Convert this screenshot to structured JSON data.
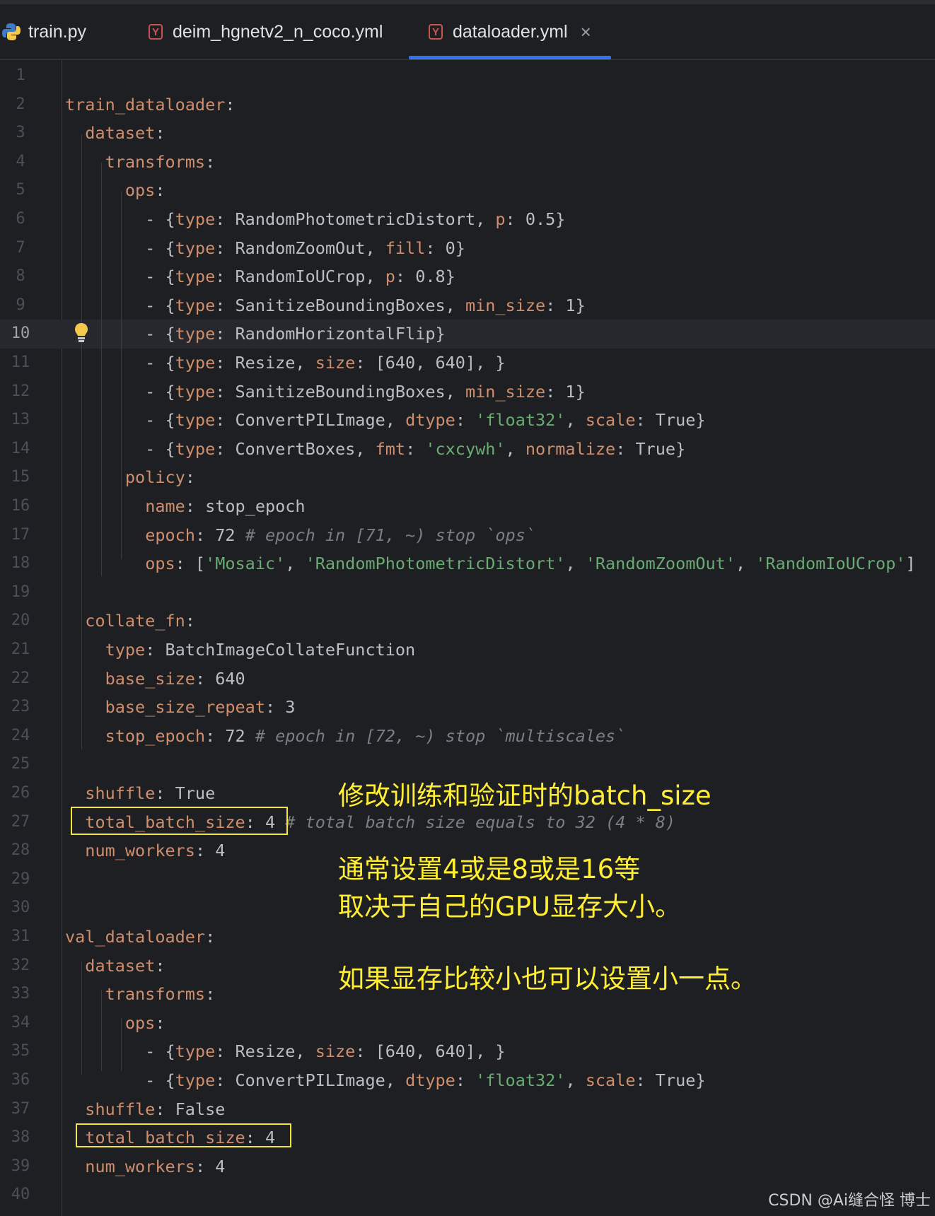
{
  "tabs": [
    {
      "label": "train.py",
      "icon": "python-file-icon"
    },
    {
      "label": "deim_hgnetv2_n_coco.yml",
      "icon": "yaml-file-icon"
    },
    {
      "label": "dataloader.yml",
      "icon": "yaml-file-icon",
      "active": true,
      "close": "×"
    }
  ],
  "editor": {
    "current_line": 10,
    "line_numbers": [
      "1",
      "2",
      "3",
      "4",
      "5",
      "6",
      "7",
      "8",
      "9",
      "10",
      "11",
      "12",
      "13",
      "14",
      "15",
      "16",
      "17",
      "18",
      "19",
      "20",
      "21",
      "22",
      "23",
      "24",
      "25",
      "26",
      "27",
      "28",
      "29",
      "30",
      "31",
      "32",
      "33",
      "34",
      "35",
      "36",
      "37",
      "38",
      "39",
      "40"
    ],
    "lines": [
      [],
      [
        [
          "k",
          "train_dataloader"
        ],
        [
          "p",
          ":"
        ]
      ],
      [
        [
          "p",
          "  "
        ],
        [
          "k",
          "dataset"
        ],
        [
          "p",
          ":"
        ]
      ],
      [
        [
          "p",
          "    "
        ],
        [
          "k",
          "transforms"
        ],
        [
          "p",
          ":"
        ]
      ],
      [
        [
          "p",
          "      "
        ],
        [
          "k",
          "ops"
        ],
        [
          "p",
          ":"
        ]
      ],
      [
        [
          "p",
          "        - {"
        ],
        [
          "k",
          "type"
        ],
        [
          "p",
          ": RandomPhotometricDistort, "
        ],
        [
          "k",
          "p"
        ],
        [
          "p",
          ": 0.5}"
        ]
      ],
      [
        [
          "p",
          "        - {"
        ],
        [
          "k",
          "type"
        ],
        [
          "p",
          ": RandomZoomOut, "
        ],
        [
          "k",
          "fill"
        ],
        [
          "p",
          ": 0}"
        ]
      ],
      [
        [
          "p",
          "        - {"
        ],
        [
          "k",
          "type"
        ],
        [
          "p",
          ": RandomIoUCrop, "
        ],
        [
          "k",
          "p"
        ],
        [
          "p",
          ": 0.8}"
        ]
      ],
      [
        [
          "p",
          "        - {"
        ],
        [
          "k",
          "type"
        ],
        [
          "p",
          ": SanitizeBoundingBoxes, "
        ],
        [
          "k",
          "min_size"
        ],
        [
          "p",
          ": 1}"
        ]
      ],
      [
        [
          "p",
          "        - {"
        ],
        [
          "k",
          "type"
        ],
        [
          "p",
          ": RandomHorizontalFlip}"
        ]
      ],
      [
        [
          "p",
          "        - {"
        ],
        [
          "k",
          "type"
        ],
        [
          "p",
          ": Resize, "
        ],
        [
          "k",
          "size"
        ],
        [
          "p",
          ": [640, 640], }"
        ]
      ],
      [
        [
          "p",
          "        - {"
        ],
        [
          "k",
          "type"
        ],
        [
          "p",
          ": SanitizeBoundingBoxes, "
        ],
        [
          "k",
          "min_size"
        ],
        [
          "p",
          ": 1}"
        ]
      ],
      [
        [
          "p",
          "        - {"
        ],
        [
          "k",
          "type"
        ],
        [
          "p",
          ": ConvertPILImage, "
        ],
        [
          "k",
          "dtype"
        ],
        [
          "p",
          ": "
        ],
        [
          "s",
          "'float32'"
        ],
        [
          "p",
          ", "
        ],
        [
          "k",
          "scale"
        ],
        [
          "p",
          ": True}"
        ]
      ],
      [
        [
          "p",
          "        - {"
        ],
        [
          "k",
          "type"
        ],
        [
          "p",
          ": ConvertBoxes, "
        ],
        [
          "k",
          "fmt"
        ],
        [
          "p",
          ": "
        ],
        [
          "s",
          "'cxcywh'"
        ],
        [
          "p",
          ", "
        ],
        [
          "k",
          "normalize"
        ],
        [
          "p",
          ": True}"
        ]
      ],
      [
        [
          "p",
          "      "
        ],
        [
          "k",
          "policy"
        ],
        [
          "p",
          ":"
        ]
      ],
      [
        [
          "p",
          "        "
        ],
        [
          "k",
          "name"
        ],
        [
          "p",
          ": stop_epoch"
        ]
      ],
      [
        [
          "p",
          "        "
        ],
        [
          "k",
          "epoch"
        ],
        [
          "p",
          ": 72 "
        ],
        [
          "c",
          "# epoch in [71, ~) stop `ops`"
        ]
      ],
      [
        [
          "p",
          "        "
        ],
        [
          "k",
          "ops"
        ],
        [
          "p",
          ": ["
        ],
        [
          "s",
          "'Mosaic'"
        ],
        [
          "p",
          ", "
        ],
        [
          "s",
          "'RandomPhotometricDistort'"
        ],
        [
          "p",
          ", "
        ],
        [
          "s",
          "'RandomZoomOut'"
        ],
        [
          "p",
          ", "
        ],
        [
          "s",
          "'RandomIoUCrop'"
        ],
        [
          "p",
          "]"
        ]
      ],
      [],
      [
        [
          "p",
          "  "
        ],
        [
          "k",
          "collate_fn"
        ],
        [
          "p",
          ":"
        ]
      ],
      [
        [
          "p",
          "    "
        ],
        [
          "k",
          "type"
        ],
        [
          "p",
          ": BatchImageCollateFunction"
        ]
      ],
      [
        [
          "p",
          "    "
        ],
        [
          "k",
          "base_size"
        ],
        [
          "p",
          ": 640"
        ]
      ],
      [
        [
          "p",
          "    "
        ],
        [
          "k",
          "base_size_repeat"
        ],
        [
          "p",
          ": 3"
        ]
      ],
      [
        [
          "p",
          "    "
        ],
        [
          "k",
          "stop_epoch"
        ],
        [
          "p",
          ": 72 "
        ],
        [
          "c",
          "# epoch in [72, ~) stop `multiscales`"
        ]
      ],
      [],
      [
        [
          "p",
          "  "
        ],
        [
          "k",
          "shuffle"
        ],
        [
          "p",
          ": True"
        ]
      ],
      [
        [
          "p",
          "  "
        ],
        [
          "k",
          "total_batch_size"
        ],
        [
          "p",
          ": 4 "
        ],
        [
          "c",
          "# total batch size equals to 32 (4 * 8)"
        ]
      ],
      [
        [
          "p",
          "  "
        ],
        [
          "k",
          "num_workers"
        ],
        [
          "p",
          ": 4"
        ]
      ],
      [],
      [],
      [
        [
          "k",
          "val_dataloader"
        ],
        [
          "p",
          ":"
        ]
      ],
      [
        [
          "p",
          "  "
        ],
        [
          "k",
          "dataset"
        ],
        [
          "p",
          ":"
        ]
      ],
      [
        [
          "p",
          "    "
        ],
        [
          "k",
          "transforms"
        ],
        [
          "p",
          ":"
        ]
      ],
      [
        [
          "p",
          "      "
        ],
        [
          "k",
          "ops"
        ],
        [
          "p",
          ":"
        ]
      ],
      [
        [
          "p",
          "        - {"
        ],
        [
          "k",
          "type"
        ],
        [
          "p",
          ": Resize, "
        ],
        [
          "k",
          "size"
        ],
        [
          "p",
          ": [640, 640], }"
        ]
      ],
      [
        [
          "p",
          "        - {"
        ],
        [
          "k",
          "type"
        ],
        [
          "p",
          ": ConvertPILImage, "
        ],
        [
          "k",
          "dtype"
        ],
        [
          "p",
          ": "
        ],
        [
          "s",
          "'float32'"
        ],
        [
          "p",
          ", "
        ],
        [
          "k",
          "scale"
        ],
        [
          "p",
          ": True}"
        ]
      ],
      [
        [
          "p",
          "  "
        ],
        [
          "k",
          "shuffle"
        ],
        [
          "p",
          ": False"
        ]
      ],
      [
        [
          "p",
          "  "
        ],
        [
          "k",
          "total_batch_size"
        ],
        [
          "p",
          ": 4"
        ]
      ],
      [
        [
          "p",
          "  "
        ],
        [
          "k",
          "num_workers"
        ],
        [
          "p",
          ": 4"
        ]
      ],
      []
    ]
  },
  "annotations": {
    "line1": "修改训练和验证时的batch_size",
    "line2": "通常设置4或是8或是16等",
    "line3": "取决于自己的GPU显存大小。",
    "line4": "如果显存比较小也可以设置小一点。"
  },
  "watermark": "CSDN @Ai缝合怪 博士",
  "colors": {
    "background": "#1e1f22",
    "keyword": "#cf8e6d",
    "string": "#6aab73",
    "comment": "#7a7e85",
    "annotation": "#ffee33",
    "tab_underline": "#3574f0"
  }
}
